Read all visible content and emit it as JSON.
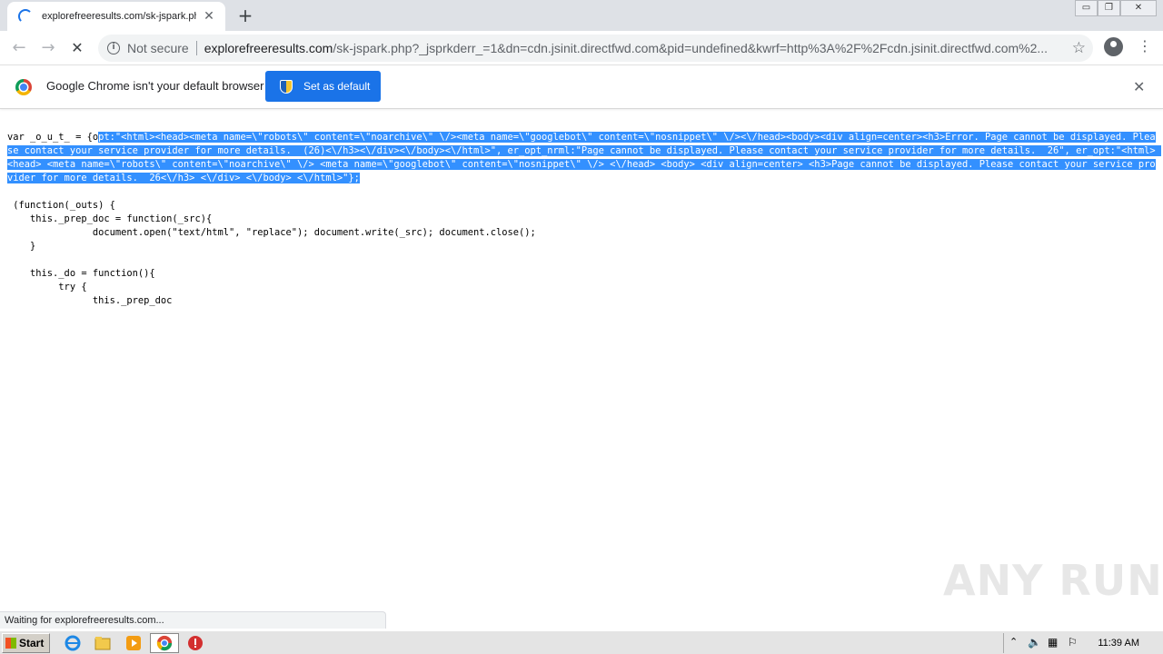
{
  "tab": {
    "title": "explorefreeresults.com/sk-jspark.ph",
    "close": "✕",
    "newtab": "+"
  },
  "window": {
    "minimize": "▭",
    "restore": "❐",
    "close": "✕"
  },
  "toolbar": {
    "back": "←",
    "forward": "→",
    "stop": "✕",
    "not_secure": "Not secure",
    "url_host": "explorefreeresults.com",
    "url_path": "/sk-jspark.php?_jsprkderr_=1&dn=cdn.jsinit.directfwd.com&pid=undefined&kwrf=http%3A%2F%2Fcdn.jsinit.directfwd.com%2...",
    "star": "☆",
    "menu": "⋮"
  },
  "infobar": {
    "message": "Google Chrome isn't your default browser",
    "button": "Set as default",
    "close": "✕"
  },
  "page": {
    "prefix": "var _o_u_t_ = {o",
    "selected": "pt:\"<html><head><meta name=\\\"robots\\\" content=\\\"noarchive\\\" \\/><meta name=\\\"googlebot\\\" content=\\\"nosnippet\\\" \\/><\\/head><body><div align=center><h3>Error. Page cannot be displayed. Please contact your service provider for more details.  (26)<\\/h3><\\/div><\\/body><\\/html>\", er_opt_nrml:\"Page cannot be displayed. Please contact your service provider for more details.  26\", er_opt:\"<html> <head> <meta name=\\\"robots\\\" content=\\\"noarchive\\\" \\/> <meta name=\\\"googlebot\\\" content=\\\"nosnippet\\\" \\/> <\\/head> <body> <div align=center> <h3>Page cannot be displayed. Please contact your service provider for more details.  26<\\/h3> <\\/div> <\\/body> <\\/html>\"};",
    "code": " (function(_outs) {\n    this._prep_doc = function(_src){\n               document.open(\"text/html\", \"replace\"); document.write(_src); document.close();\n    }\n\n    this._do = function(){\n         try {\n               this._prep_doc"
  },
  "status": {
    "text": "Waiting for explorefreeresults.com..."
  },
  "watermark": {
    "text": "ANY RUN"
  },
  "taskbar": {
    "start": "Start",
    "clock": "11:39 AM"
  }
}
